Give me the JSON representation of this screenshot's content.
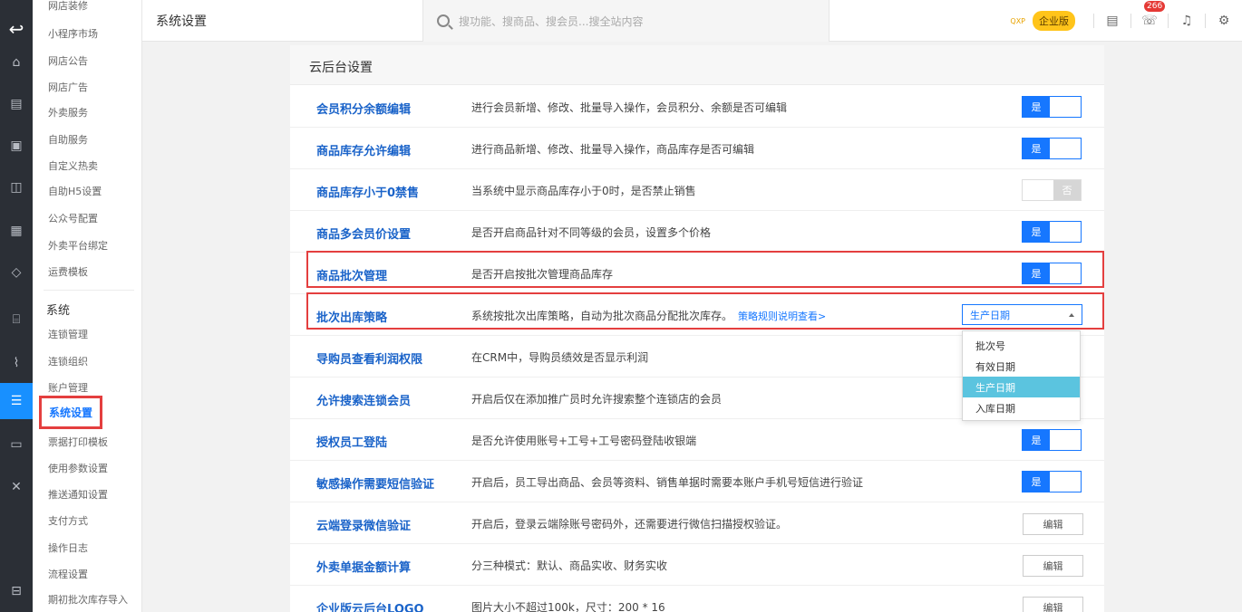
{
  "rail": {
    "icons": [
      "logo-icon",
      "home-icon",
      "shop-icon",
      "screen-icon",
      "store-icon",
      "doc-icon",
      "diamond-icon",
      "bank-icon",
      "chart-icon",
      "sliders-icon",
      "card-icon",
      "tools-icon",
      "scan-icon"
    ]
  },
  "submenu": {
    "items_top": [
      "网店装修",
      "小程序市场",
      "网店公告",
      "网店广告",
      "外卖服务",
      "自助服务",
      "自定义热卖",
      "自助H5设置",
      "公众号配置",
      "外卖平台绑定",
      "运费模板"
    ],
    "group": "系统",
    "items_system": [
      "连锁管理",
      "连锁组织",
      "账户管理",
      "系统设置",
      "票据打印模板",
      "使用参数设置",
      "推送通知设置",
      "支付方式",
      "操作日志",
      "流程设置",
      "期初批次库存导入"
    ]
  },
  "header": {
    "title": "系统设置",
    "search_placeholder": "搜功能、搜商品、搜会员...搜全站内容",
    "tiny_tag": "QXP",
    "edition": "企业版",
    "badge_count": "266"
  },
  "panel": {
    "title": "云后台设置",
    "rows": [
      {
        "label": "会员积分余额编辑",
        "desc": "进行会员新增、修改、批量导入操作，会员积分、余额是否可编辑",
        "control": "toggle-on",
        "value": "是"
      },
      {
        "label": "商品库存允许编辑",
        "desc": "进行商品新增、修改、批量导入操作，商品库存是否可编辑",
        "control": "toggle-on",
        "value": "是"
      },
      {
        "label": "商品库存小于0禁售",
        "desc": "当系统中显示商品库存小于0时，是否禁止销售",
        "control": "toggle-off",
        "value": "否"
      },
      {
        "label": "商品多会员价设置",
        "desc": "是否开启商品针对不同等级的会员，设置多个价格",
        "control": "toggle-on",
        "value": "是"
      },
      {
        "label": "商品批次管理",
        "desc": "是否开启按批次管理商品库存",
        "control": "toggle-on",
        "value": "是"
      },
      {
        "label": "批次出库策略",
        "desc": "系统按批次出库策略，自动为批次商品分配批次库存。",
        "link": "策略规则说明查看>",
        "control": "select",
        "value": "生产日期"
      },
      {
        "label": "导购员查看利润权限",
        "desc": "在CRM中，导购员绩效是否显示利润",
        "control": "none"
      },
      {
        "label": "允许搜索连锁会员",
        "desc": "开启后仅在添加推广员时允许搜索整个连锁店的会员",
        "control": "none"
      },
      {
        "label": "授权员工登陆",
        "desc": "是否允许使用账号+工号+工号密码登陆收银端",
        "control": "toggle-on",
        "value": "是"
      },
      {
        "label": "敏感操作需要短信验证",
        "desc": "开启后，员工导出商品、会员等资料、销售单据时需要本账户手机号短信进行验证",
        "control": "toggle-on",
        "value": "是"
      },
      {
        "label": "云端登录微信验证",
        "desc": "开启后，登录云端除账号密码外，还需要进行微信扫描授权验证。",
        "control": "button",
        "value": "编辑"
      },
      {
        "label": "外卖单据金额计算",
        "desc": "分三种模式：默认、商品实收、财务实收",
        "control": "button",
        "value": "编辑"
      },
      {
        "label": "企业版云后台LOGO",
        "desc": "图片大小不超过100k，尺寸：200 * 16",
        "control": "button",
        "value": "编辑"
      }
    ]
  },
  "dropdown": {
    "options": [
      "批次号",
      "有效日期",
      "生产日期",
      "入库日期"
    ],
    "selected": "生产日期"
  },
  "colors": {
    "accent": "#1677ff",
    "highlight": "#e43f3f",
    "selected_option": "#5bc4df"
  }
}
